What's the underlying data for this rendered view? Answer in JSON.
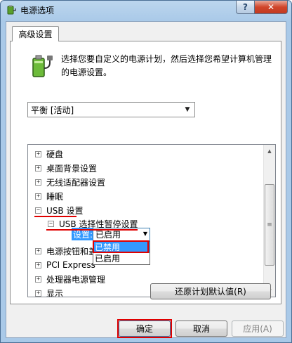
{
  "window": {
    "title": "电源选项",
    "help_label": "?",
    "close_label": "✕"
  },
  "tab": {
    "label": "高级设置"
  },
  "description": "选择您要自定义的电源计划，然后选择您希望计算机管理的电源设置。",
  "plan_select": {
    "value": "平衡 [活动]"
  },
  "tree": {
    "items": [
      {
        "label": "硬盘",
        "expander": "+"
      },
      {
        "label": "桌面背景设置",
        "expander": "+"
      },
      {
        "label": "无线适配器设置",
        "expander": "+"
      },
      {
        "label": "睡眠",
        "expander": "+"
      },
      {
        "label": "USB 设置",
        "expander": "−"
      },
      {
        "label": "USB 选择性暂停设置",
        "expander": "−"
      },
      {
        "label": "电源按钮和盖",
        "expander": "+"
      },
      {
        "label": "PCI Express",
        "expander": "+"
      },
      {
        "label": "处理器电源管理",
        "expander": "+"
      },
      {
        "label": "显示",
        "expander": "+"
      }
    ],
    "setting_label": "设置:",
    "setting_value": "已启用",
    "dropdown_options": [
      "已禁用",
      "已启用"
    ]
  },
  "buttons": {
    "restore": "还原计划默认值(R)",
    "ok": "确定",
    "cancel": "取消",
    "apply": "应用(A)"
  },
  "icons": {
    "app": "power-options-icon",
    "battery": "battery-plug-icon",
    "dropdown": "chevron-down-icon"
  },
  "colors": {
    "highlight": "#3399ff",
    "annotation": "#e00000"
  }
}
